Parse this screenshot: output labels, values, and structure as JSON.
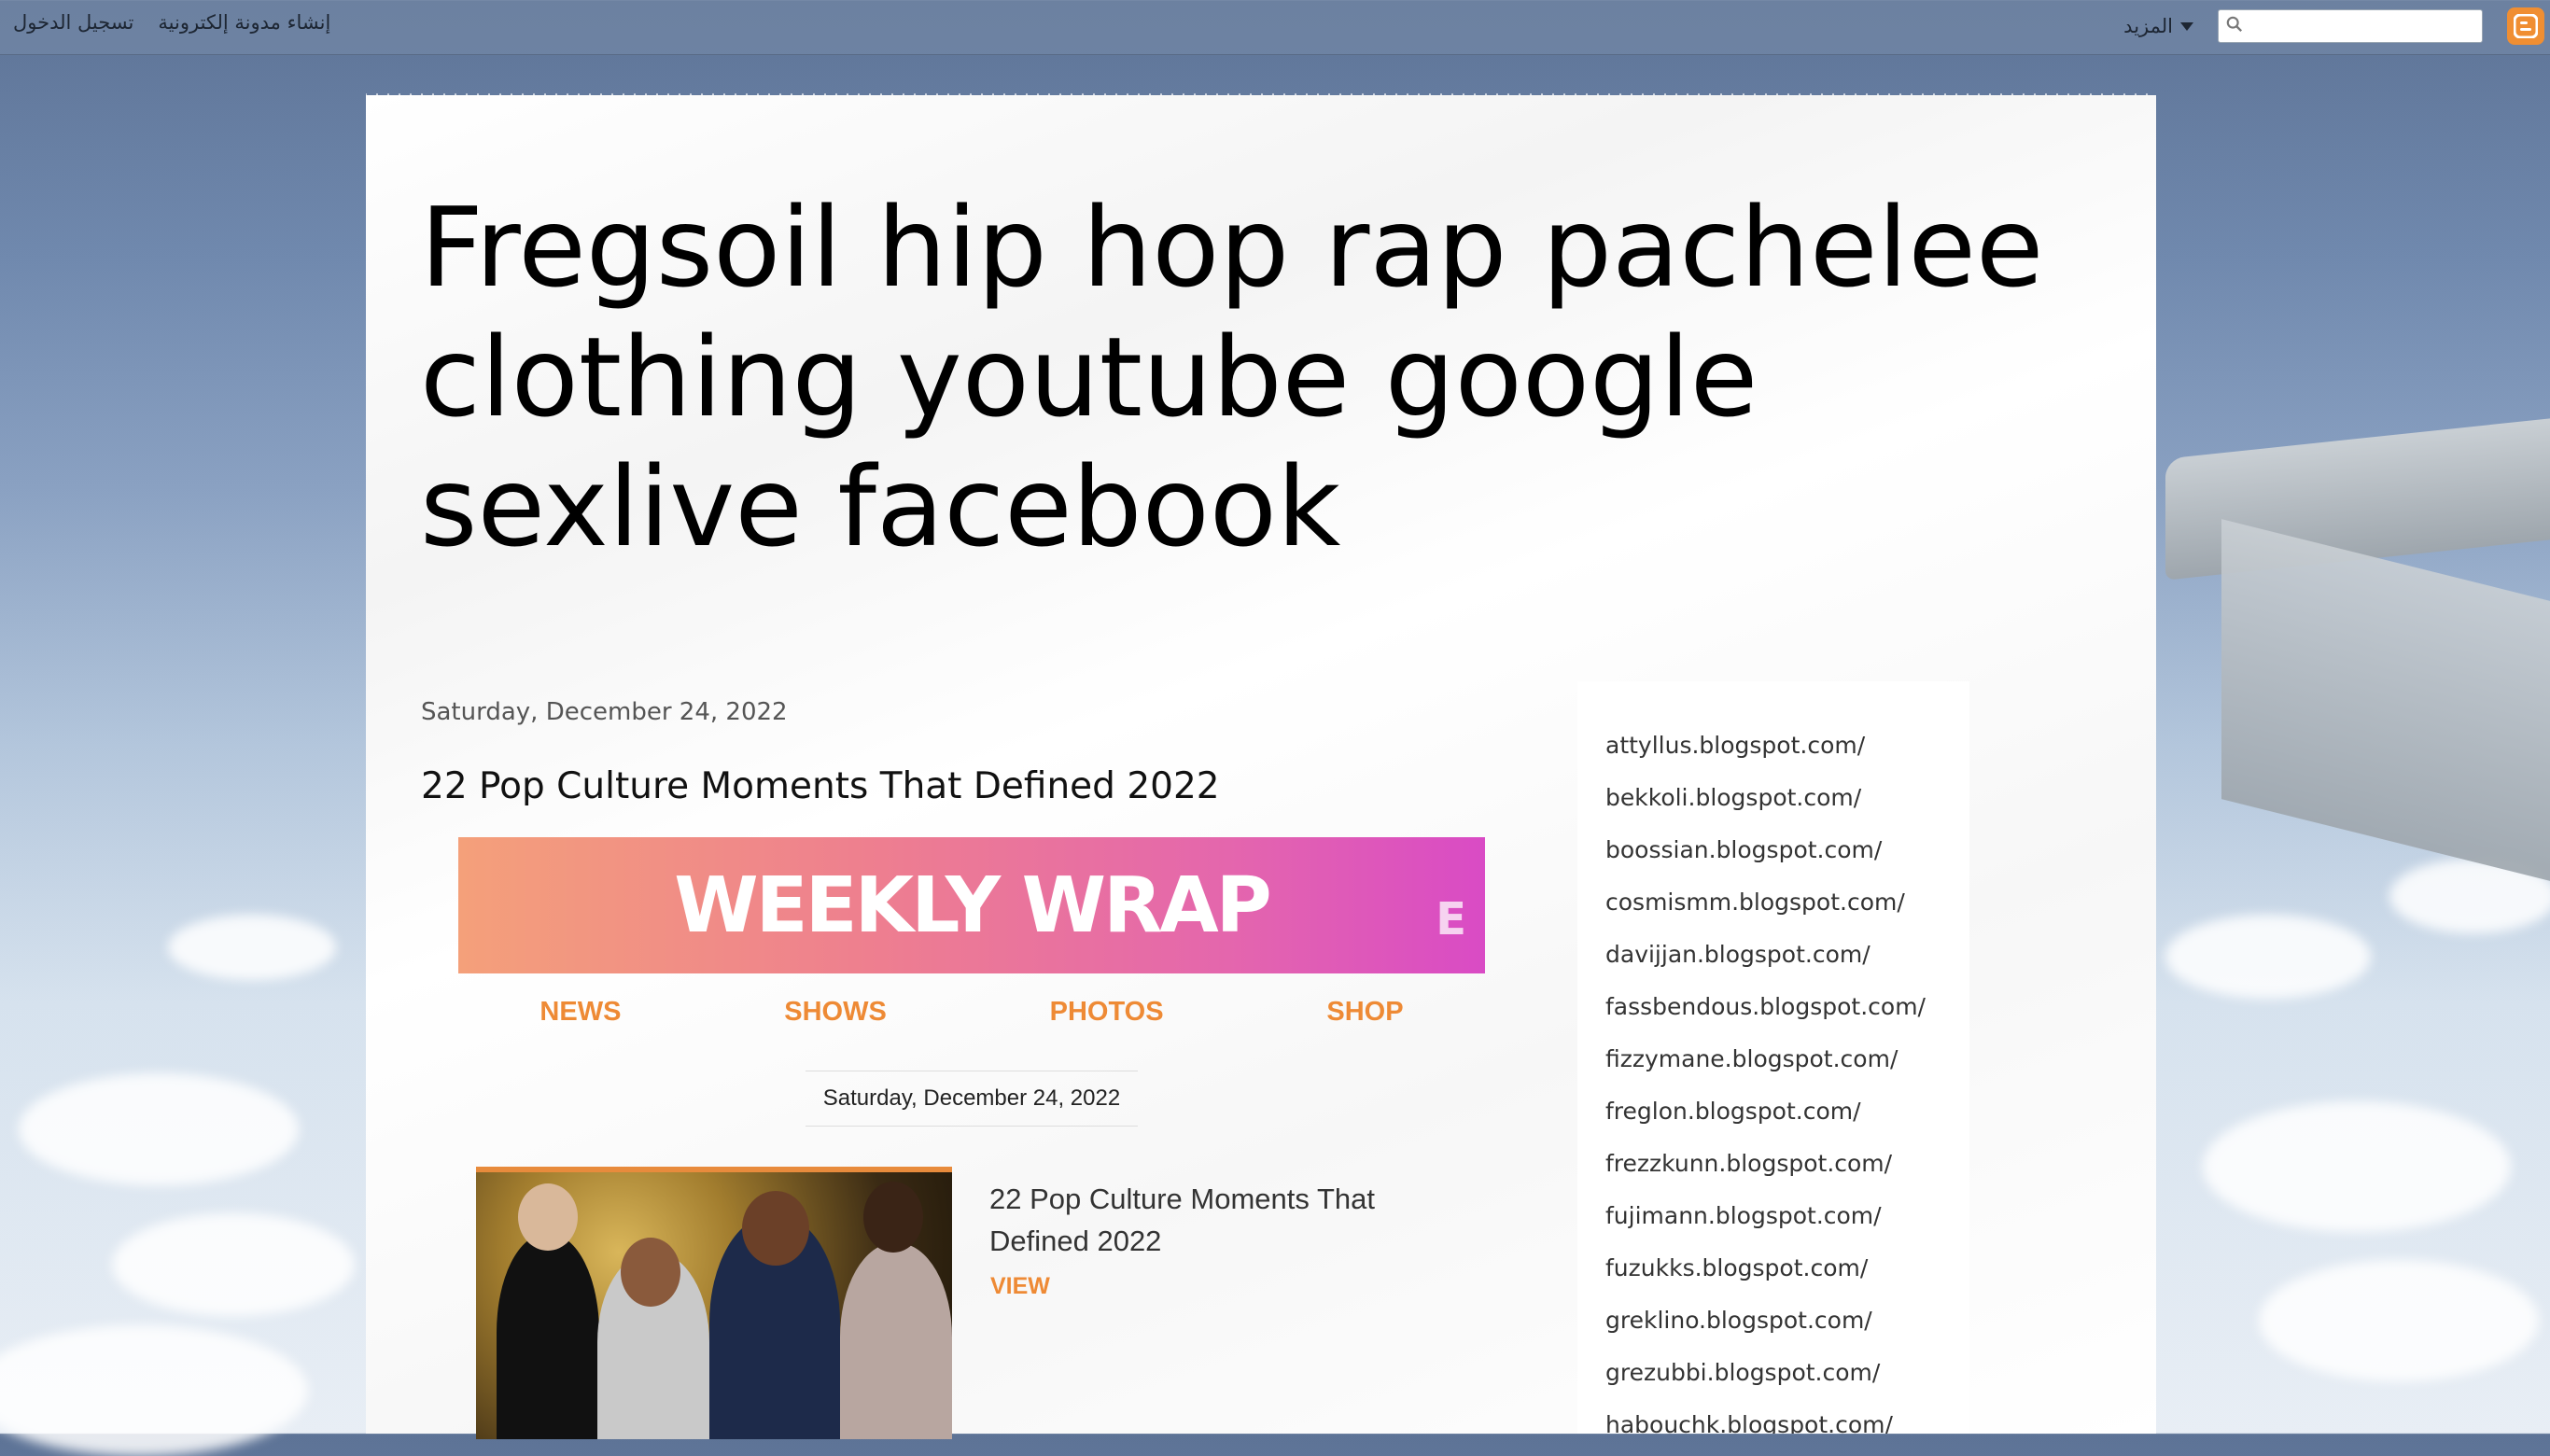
{
  "navbar": {
    "login": "تسجيل الدخول",
    "create_blog": "إنشاء مدونة إلكترونية",
    "more": "المزيد",
    "search_placeholder": ""
  },
  "blog": {
    "title": "Fregsoil hip hop rap pachelee clothing youtube google sexlive facebook"
  },
  "post": {
    "date": "Saturday, December 24, 2022",
    "title": "22 Pop Culture Moments That Defined 2022"
  },
  "newsletter": {
    "banner": "WEEKLY WRAP",
    "logo": "E",
    "tabs": [
      "NEWS",
      "SHOWS",
      "PHOTOS",
      "SHOP"
    ],
    "date": "Saturday, December 24, 2022",
    "article_title": "22 Pop Culture Moments That Defined 2022",
    "view": "VIEW"
  },
  "sidebar": {
    "links": [
      "attyllus.blogspot.com/",
      "bekkoli.blogspot.com/",
      "boossian.blogspot.com/",
      "cosmismm.blogspot.com/",
      "davijjan.blogspot.com/",
      "fassbendous.blogspot.com/",
      "fizzymane.blogspot.com/",
      "freglon.blogspot.com/",
      "frezzkunn.blogspot.com/",
      "fujimann.blogspot.com/",
      "fuzukks.blogspot.com/",
      "greklino.blogspot.com/",
      "grezubbi.blogspot.com/",
      "habouchk.blogspot.com/"
    ]
  },
  "colors": {
    "accent": "#ee8a35",
    "blogger": "#f08e32"
  }
}
